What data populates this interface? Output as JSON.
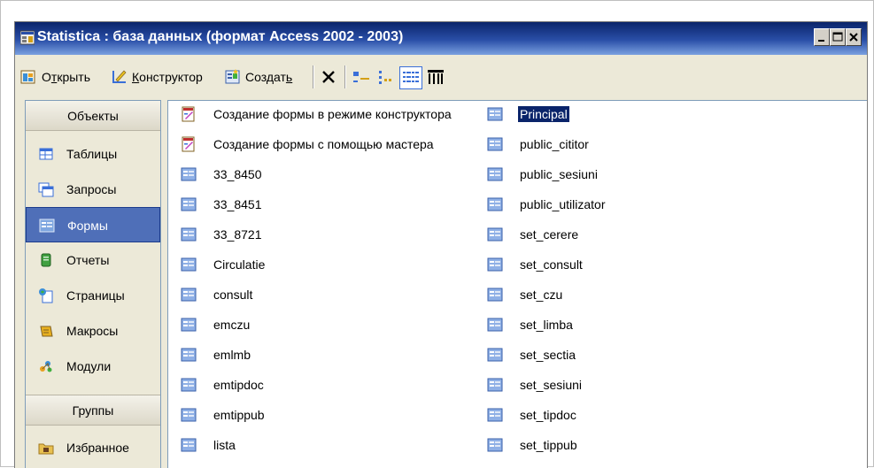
{
  "window": {
    "title": "Statistica : база данных (формат Access 2002 - 2003)",
    "controls": [
      "minimize",
      "maximize",
      "close"
    ]
  },
  "toolbar": {
    "open": {
      "pre": "О",
      "ul": "т",
      "post": "крыть",
      "icon": "open-icon"
    },
    "design": {
      "ul": "К",
      "post": "онструктор",
      "icon": "design-icon"
    },
    "create": {
      "pre": "Создат",
      "ul": "ь",
      "post": "",
      "icon": "new-form-icon"
    },
    "tools": [
      "delete-icon",
      "large-icons-icon",
      "small-icons-icon",
      "list-view-icon",
      "details-view-icon"
    ]
  },
  "left_pane": {
    "objects_header": "Объекты",
    "objects": [
      {
        "label": "Таблицы",
        "icon": "table-icon",
        "selected": false
      },
      {
        "label": "Запросы",
        "icon": "query-icon",
        "selected": false
      },
      {
        "label": "Формы",
        "icon": "form-icon",
        "selected": true
      },
      {
        "label": "Отчеты",
        "icon": "report-icon",
        "selected": false
      },
      {
        "label": "Страницы",
        "icon": "page-icon",
        "selected": false
      },
      {
        "label": "Макросы",
        "icon": "macro-icon",
        "selected": false
      },
      {
        "label": "Модули",
        "icon": "module-icon",
        "selected": false
      }
    ],
    "groups_header": "Группы",
    "groups": [
      {
        "label": "Избранное",
        "icon": "favorites-folder-icon"
      }
    ]
  },
  "forms_list": {
    "column1": [
      {
        "label": "Создание формы в режиме конструктора",
        "icon": "wizard-icon"
      },
      {
        "label": "Создание формы с помощью мастера",
        "icon": "wizard-icon"
      },
      {
        "label": "33_8450",
        "icon": "form-icon"
      },
      {
        "label": "33_8451",
        "icon": "form-icon"
      },
      {
        "label": "33_8721",
        "icon": "form-icon"
      },
      {
        "label": "Circulatie",
        "icon": "form-icon"
      },
      {
        "label": "consult",
        "icon": "form-icon"
      },
      {
        "label": "emczu",
        "icon": "form-icon"
      },
      {
        "label": "emlmb",
        "icon": "form-icon"
      },
      {
        "label": "emtipdoc",
        "icon": "form-icon"
      },
      {
        "label": "emtippub",
        "icon": "form-icon"
      },
      {
        "label": "lista",
        "icon": "form-icon"
      }
    ],
    "column2": [
      {
        "label": "Principal",
        "icon": "form-icon",
        "selected": true
      },
      {
        "label": "public_cititor",
        "icon": "form-icon"
      },
      {
        "label": "public_sesiuni",
        "icon": "form-icon"
      },
      {
        "label": "public_utilizator",
        "icon": "form-icon"
      },
      {
        "label": "set_cerere",
        "icon": "form-icon"
      },
      {
        "label": "set_consult",
        "icon": "form-icon"
      },
      {
        "label": "set_czu",
        "icon": "form-icon"
      },
      {
        "label": "set_limba",
        "icon": "form-icon"
      },
      {
        "label": "set_sectia",
        "icon": "form-icon"
      },
      {
        "label": "set_sesiuni",
        "icon": "form-icon"
      },
      {
        "label": "set_tipdoc",
        "icon": "form-icon"
      },
      {
        "label": "set_tippub",
        "icon": "form-icon"
      }
    ]
  },
  "colors": {
    "title_bar": "#0a246a",
    "selection": "#0a246a",
    "selected_object": "#4f6fb8",
    "panel_bg": "#ece9d8"
  }
}
